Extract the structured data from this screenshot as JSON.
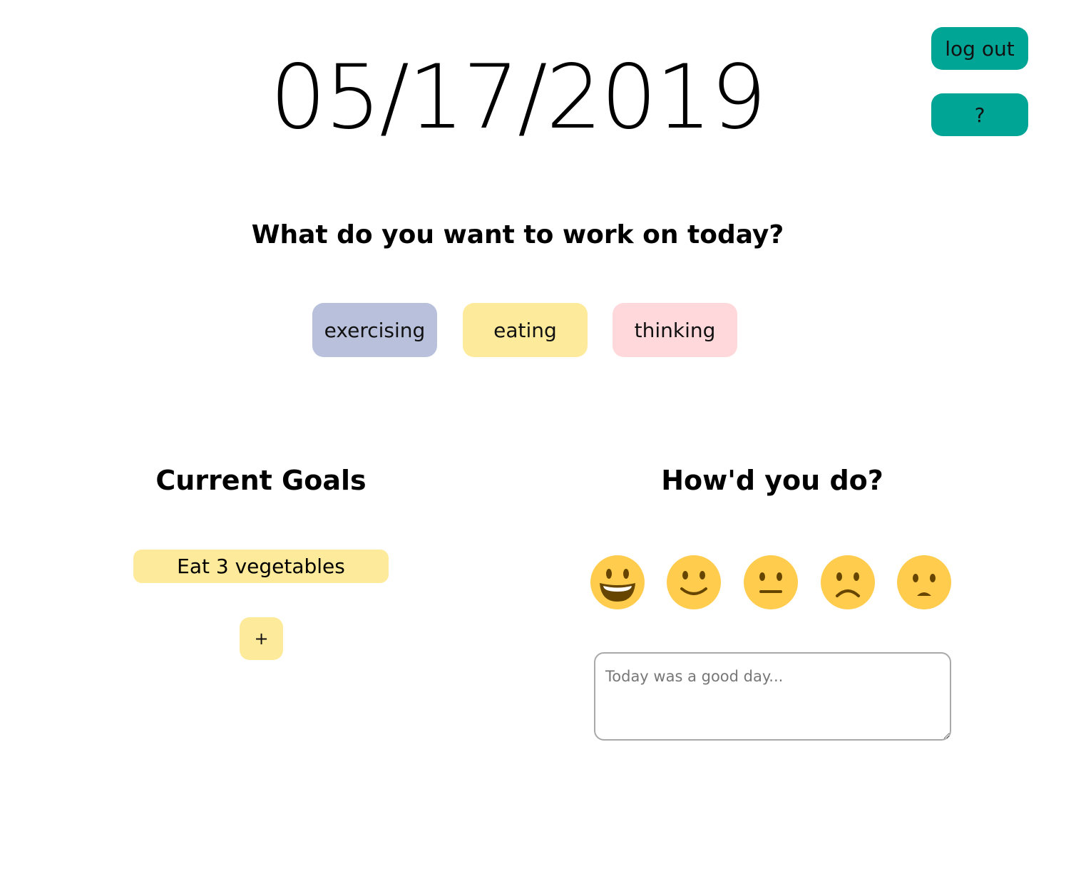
{
  "header": {
    "date": "05/17/2019"
  },
  "top_buttons": {
    "logout_label": "log out",
    "help_label": "?"
  },
  "focus": {
    "question": "What do you want to work on today?",
    "categories": [
      {
        "label": "exercising",
        "color": "#b9c0dc"
      },
      {
        "label": "eating",
        "color": "#fdea9b"
      },
      {
        "label": "thinking",
        "color": "#fed8da"
      }
    ]
  },
  "goals": {
    "heading": "Current Goals",
    "items": [
      "Eat 3 vegetables"
    ],
    "add_label": "+"
  },
  "rating": {
    "heading": "How'd you do?",
    "moods": [
      "grinning-face-icon",
      "slightly-smiling-face-icon",
      "neutral-face-icon",
      "slightly-frowning-face-icon",
      "frowning-face-icon"
    ],
    "reflection_placeholder": "Today was a good day..."
  },
  "colors": {
    "accent": "#00a596",
    "emoji": "#ffcc4d"
  }
}
